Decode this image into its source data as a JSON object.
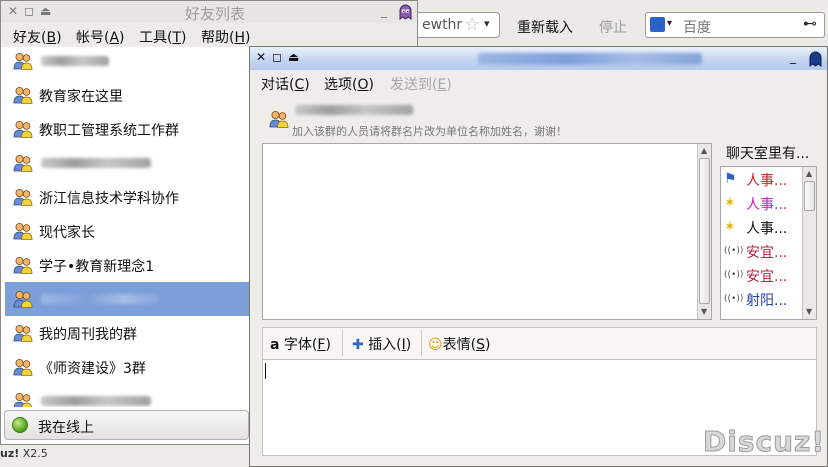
{
  "browser": {
    "url_text": "ewthr",
    "reload_label": "重新载入",
    "stop_label": "停止",
    "search_placeholder": "百度"
  },
  "footer": {
    "brand": "uz!",
    "version": "X2.5"
  },
  "friends_window": {
    "title": "好友列表",
    "menu": [
      {
        "label": "好友(",
        "key": "B"
      },
      {
        "label": "帐号(",
        "key": "A"
      },
      {
        "label": "工具(",
        "key": "T"
      },
      {
        "label": "帮助(",
        "key": "H"
      }
    ],
    "friends": [
      {
        "name": "",
        "blurred": true
      },
      {
        "name": "教育家在这里"
      },
      {
        "name": "教职工管理系统工作群"
      },
      {
        "name": "",
        "blurred": true
      },
      {
        "name": "浙江信息技术学科协作"
      },
      {
        "name": "现代家长"
      },
      {
        "name": "学子•教育新理念1"
      },
      {
        "name": "",
        "blurred": true,
        "selected": true
      },
      {
        "name": "我的周刊我的群"
      },
      {
        "name": "《师资建设》3群"
      },
      {
        "name": "",
        "blurred": true
      }
    ],
    "status_label": "我在线上"
  },
  "chat_window": {
    "menu": [
      {
        "label": "对话(",
        "key": "C",
        "enabled": true
      },
      {
        "label": "选项(",
        "key": "O",
        "enabled": true
      },
      {
        "label": "发送到(",
        "key": "E",
        "enabled": false
      }
    ],
    "group_notice": "加入该群的人员请将群名片改为单位名称加姓名，谢谢！",
    "members_title": "聊天室里有...",
    "members": [
      {
        "name": "人事...",
        "icon": "flag-icon",
        "color": "#d02020"
      },
      {
        "name": "人事...",
        "icon": "star-icon",
        "color": "#c020c0"
      },
      {
        "name": "人事...",
        "icon": "star-icon",
        "color": "#111111"
      },
      {
        "name": "安宜...",
        "icon": "broadcast-icon",
        "color": "#c02040"
      },
      {
        "name": "安宜...",
        "icon": "broadcast-icon",
        "color": "#c02040"
      },
      {
        "name": "射阳...",
        "icon": "broadcast-icon",
        "color": "#2040b0"
      }
    ],
    "tools": [
      {
        "label": "字体(",
        "key": "F",
        "icon": "font-icon"
      },
      {
        "label": "插入(",
        "key": "I",
        "icon": "plus-icon"
      },
      {
        "label": "表情(",
        "key": "S",
        "icon": "smiley-icon"
      }
    ],
    "watermark": "Discuz!"
  }
}
